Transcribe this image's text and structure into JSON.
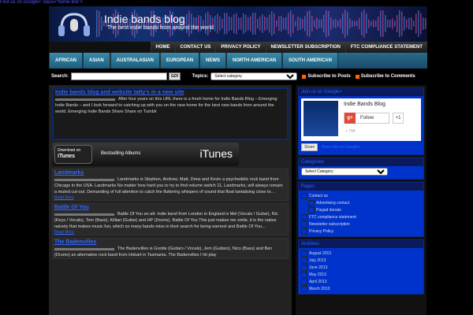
{
  "gplus_link": "Find us on Google+ class=\"home-link\">",
  "header": {
    "title": "Indie bands blog",
    "tagline": "The best indie bands from around the world"
  },
  "top_nav": [
    "HOME",
    "CONTACT US",
    "PRIVACY POLICY",
    "NEWSLETTER SUBSCRIPTION",
    "FTC COMPLIANCE STATEMENT"
  ],
  "category_nav": [
    "AFRICAN",
    "ASIAN",
    "AUSTRALASIAN",
    "EUROPEAN",
    "NEWS",
    "NORTH AMERICAN",
    "SOUTH AMERICAN"
  ],
  "search": {
    "label": "Search:",
    "value": "",
    "go_label": "GO!",
    "topics_label": "Topics:",
    "topics_selected": "Select category",
    "subscribe_posts": "Subscribe to Posts",
    "subscribe_comments": "Subscribe to Comments"
  },
  "posts": [
    {
      "title": "Indie bands blog and website tatty's in a new site",
      "meta": "",
      "body": "After four years on this URL there is a fresh home for Indie Bands Blog – Emerging Indie Bands – and I look forward to catching up with you on the new home for the best new bands from around the world. Emerging Indie Bands Share Share on Tumblr",
      "more": ""
    },
    {
      "title": "Landmarks",
      "meta": "",
      "body": "Landmarks is Stephen, Andrew, Matt, Drew and Kevin a psychedelic rock band from Chicago in the USA. Landmarks No matter how hard you to try to find volume switch 11, Landmarks, will always remain a muted cut-out. Demanding of full attention to catch the fluttering whispers of sound that float tantalising close to…",
      "more": "Read More"
    },
    {
      "title": "Battle Of You",
      "meta": "",
      "body": "Battle Of You an alt- indie band from London in England is Mel (Vocals / Guitar), Nic (Keys / Vocals), Tom (Bass),  Killian (Guitar) and HP (Drums). Battle Of You This just makes me smile, it is the native naivety that makes music fun, which so many bands miss in their search for being earnest and Battle Of You…",
      "more": "Read More"
    },
    {
      "title": "The Badenvilles",
      "meta": "",
      "body": "The Badenvilles is Gordie (Guitars / Vocals), Jem (Guitars), Nico (Bass) and Ben (Drums) an alternative rock band from Hobart in Tasmania. The Badenvilles I hit play",
      "more": ""
    }
  ],
  "itunes_banner": {
    "download": "Download on",
    "itunes_small": "iTunes",
    "bestselling": "Bestselling Albums",
    "logo": "iTunes"
  },
  "sidebar": {
    "gplus_widget": {
      "heading": "Join us on Google+",
      "name": "Indie Bands Blog",
      "follow": "Follow",
      "plus_one": "+1",
      "count": "+ 794",
      "share": "Share",
      "share_text": "Share this on Google+"
    },
    "categories": {
      "heading": "Categories",
      "selected": "Select Category"
    },
    "pages": {
      "heading": "Pages",
      "items": [
        {
          "label": "Contact us",
          "indent": 0
        },
        {
          "label": "Advertising contact",
          "indent": 1
        },
        {
          "label": "Paypal donate",
          "indent": 1
        },
        {
          "label": "FTC compliance statement",
          "indent": 0
        },
        {
          "label": "Newsletter subscription",
          "indent": 0
        },
        {
          "label": "Privacy Policy",
          "indent": 0
        }
      ]
    },
    "archives": {
      "heading": "Archives",
      "items": [
        "August 2013",
        "July 2013",
        "June 2013",
        "May 2013",
        "April 2013",
        "March 2013"
      ]
    }
  }
}
